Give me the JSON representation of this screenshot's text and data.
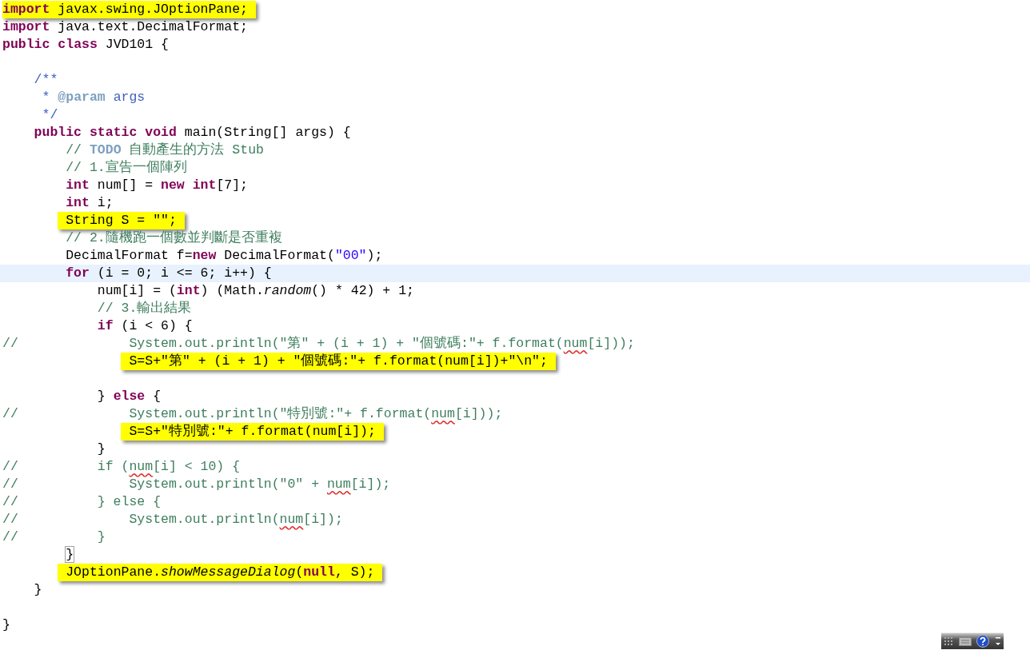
{
  "editor": {
    "lines": [
      {
        "kind": "code",
        "highlighted": true,
        "current": false,
        "tokens": [
          {
            "kind": "kw",
            "text": "import"
          },
          {
            "kind": "plain",
            "text": " javax.swing.JOptionPane;"
          }
        ]
      },
      {
        "kind": "code",
        "highlighted": false,
        "current": false,
        "tokens": [
          {
            "kind": "kw",
            "text": "import"
          },
          {
            "kind": "plain",
            "text": " java.text.DecimalFormat;"
          }
        ]
      },
      {
        "kind": "code",
        "highlighted": false,
        "current": false,
        "tokens": [
          {
            "kind": "kw",
            "text": "public"
          },
          {
            "kind": "kw",
            "text": " class"
          },
          {
            "kind": "plain",
            "text": " JVD101 {"
          }
        ]
      },
      {
        "kind": "blank"
      },
      {
        "kind": "code",
        "highlighted": false,
        "current": false,
        "tokens": [
          {
            "kind": "doc",
            "text": "    /**"
          }
        ]
      },
      {
        "kind": "code",
        "highlighted": false,
        "current": false,
        "tokens": [
          {
            "kind": "doc",
            "text": "     * "
          },
          {
            "kind": "tag",
            "text": "@param"
          },
          {
            "kind": "doc",
            "text": " args"
          }
        ]
      },
      {
        "kind": "code",
        "highlighted": false,
        "current": false,
        "tokens": [
          {
            "kind": "doc",
            "text": "     */"
          }
        ]
      },
      {
        "kind": "code",
        "highlighted": false,
        "current": false,
        "tokens": [
          {
            "kind": "kw",
            "text": "    public"
          },
          {
            "kind": "kw",
            "text": " static"
          },
          {
            "kind": "kw",
            "text": " void"
          },
          {
            "kind": "plain",
            "text": " main(String[] args) {"
          }
        ]
      },
      {
        "kind": "code",
        "highlighted": false,
        "current": false,
        "tokens": [
          {
            "kind": "cmt",
            "text": "        // "
          },
          {
            "kind": "todo",
            "text": "TODO"
          },
          {
            "kind": "cmt",
            "text": " 自動產生的方法 Stub"
          }
        ]
      },
      {
        "kind": "code",
        "highlighted": false,
        "current": false,
        "tokens": [
          {
            "kind": "cmt",
            "text": "        // 1.宣告一個陣列"
          }
        ]
      },
      {
        "kind": "code",
        "highlighted": false,
        "current": false,
        "tokens": [
          {
            "kind": "kw",
            "text": "        int"
          },
          {
            "kind": "plain",
            "text": " num[] = "
          },
          {
            "kind": "kw",
            "text": "new"
          },
          {
            "kind": "kw",
            "text": " int"
          },
          {
            "kind": "plain",
            "text": "[7];"
          }
        ]
      },
      {
        "kind": "code",
        "highlighted": false,
        "current": false,
        "tokens": [
          {
            "kind": "kw",
            "text": "        int"
          },
          {
            "kind": "plain",
            "text": " i;"
          }
        ]
      },
      {
        "kind": "code",
        "highlighted": true,
        "current": false,
        "tokens": [
          {
            "kind": "plain",
            "text": "        String S = \"\";"
          }
        ]
      },
      {
        "kind": "code",
        "highlighted": false,
        "current": false,
        "tokens": [
          {
            "kind": "cmt",
            "text": "        // 2.隨機跑一個數並判斷是否重複"
          }
        ]
      },
      {
        "kind": "code",
        "highlighted": false,
        "current": false,
        "tokens": [
          {
            "kind": "plain",
            "text": "        DecimalFormat f="
          },
          {
            "kind": "kw",
            "text": "new"
          },
          {
            "kind": "plain",
            "text": " DecimalFormat("
          },
          {
            "kind": "str",
            "text": "\"00\""
          },
          {
            "kind": "plain",
            "text": ");"
          }
        ]
      },
      {
        "kind": "code",
        "highlighted": false,
        "current": true,
        "tokens": [
          {
            "kind": "kw",
            "text": "        for"
          },
          {
            "kind": "plain",
            "text": " (i = 0; i <= 6; i++) {"
          }
        ]
      },
      {
        "kind": "code",
        "highlighted": false,
        "current": false,
        "tokens": [
          {
            "kind": "plain",
            "text": "            num[i] = ("
          },
          {
            "kind": "kw",
            "text": "int"
          },
          {
            "kind": "plain",
            "text": ") (Math."
          },
          {
            "kind": "static",
            "text": "random"
          },
          {
            "kind": "plain",
            "text": "() * 42) + 1;"
          }
        ]
      },
      {
        "kind": "code",
        "highlighted": false,
        "current": false,
        "tokens": [
          {
            "kind": "cmt",
            "text": "            // 3.輸出結果"
          }
        ]
      },
      {
        "kind": "code",
        "highlighted": false,
        "current": false,
        "tokens": [
          {
            "kind": "kw",
            "text": "            if"
          },
          {
            "kind": "plain",
            "text": " (i < 6) {"
          }
        ]
      },
      {
        "kind": "code",
        "highlighted": false,
        "current": false,
        "tokens": [
          {
            "kind": "cmt",
            "text": "//              System.out.println(\"第\" + (i + 1) + \"個號碼:\"+ f.format("
          },
          {
            "kind": "warn",
            "text": "num"
          },
          {
            "kind": "cmt",
            "text": "[i]));"
          }
        ]
      },
      {
        "kind": "code",
        "highlighted": true,
        "current": false,
        "tokens": [
          {
            "kind": "plain",
            "text": "                S=S+\"第\" + (i + 1) + \"個號碼:\"+ f.format(num[i])+\"\\n\";"
          }
        ]
      },
      {
        "kind": "blank"
      },
      {
        "kind": "code",
        "highlighted": false,
        "current": false,
        "tokens": [
          {
            "kind": "plain",
            "text": "            }"
          },
          {
            "kind": "kw",
            "text": " else"
          },
          {
            "kind": "plain",
            "text": " {"
          }
        ]
      },
      {
        "kind": "code",
        "highlighted": false,
        "current": false,
        "tokens": [
          {
            "kind": "cmt",
            "text": "//              System.out.println(\"特別號:\"+ f.format("
          },
          {
            "kind": "warn",
            "text": "num"
          },
          {
            "kind": "cmt",
            "text": "[i]));"
          }
        ]
      },
      {
        "kind": "code",
        "highlighted": true,
        "current": false,
        "tokens": [
          {
            "kind": "plain",
            "text": "                S=S+\"特別號:\"+ f.format(num[i]);"
          }
        ]
      },
      {
        "kind": "code",
        "highlighted": false,
        "current": false,
        "tokens": [
          {
            "kind": "plain",
            "text": "            }"
          }
        ]
      },
      {
        "kind": "code",
        "highlighted": false,
        "current": false,
        "tokens": [
          {
            "kind": "cmt",
            "text": "//          if ("
          },
          {
            "kind": "warn",
            "text": "num"
          },
          {
            "kind": "cmt",
            "text": "[i] < 10) {"
          }
        ]
      },
      {
        "kind": "code",
        "highlighted": false,
        "current": false,
        "tokens": [
          {
            "kind": "cmt",
            "text": "//              System.out.println(\"0\" + "
          },
          {
            "kind": "warn",
            "text": "num"
          },
          {
            "kind": "cmt",
            "text": "[i]);"
          }
        ]
      },
      {
        "kind": "code",
        "highlighted": false,
        "current": false,
        "tokens": [
          {
            "kind": "cmt",
            "text": "//          } else {"
          }
        ]
      },
      {
        "kind": "code",
        "highlighted": false,
        "current": false,
        "tokens": [
          {
            "kind": "cmt",
            "text": "//              System.out.println("
          },
          {
            "kind": "warn",
            "text": "num"
          },
          {
            "kind": "cmt",
            "text": "[i]);"
          }
        ]
      },
      {
        "kind": "code",
        "highlighted": false,
        "current": false,
        "tokens": [
          {
            "kind": "cmt",
            "text": "//          }"
          }
        ]
      },
      {
        "kind": "code",
        "highlighted": false,
        "current": false,
        "tokens": [
          {
            "kind": "match",
            "text": "        }"
          }
        ]
      },
      {
        "kind": "code",
        "highlighted": true,
        "current": false,
        "tokens": [
          {
            "kind": "plain",
            "text": "        JOptionPane."
          },
          {
            "kind": "static",
            "text": "showMessageDialog"
          },
          {
            "kind": "plain",
            "text": "("
          },
          {
            "kind": "kw",
            "text": "null"
          },
          {
            "kind": "plain",
            "text": ", S);"
          }
        ]
      },
      {
        "kind": "code",
        "highlighted": false,
        "current": false,
        "tokens": [
          {
            "kind": "plain",
            "text": "    }"
          }
        ]
      },
      {
        "kind": "blank"
      },
      {
        "kind": "code",
        "highlighted": false,
        "current": false,
        "tokens": [
          {
            "kind": "plain",
            "text": "}"
          }
        ]
      }
    ]
  }
}
